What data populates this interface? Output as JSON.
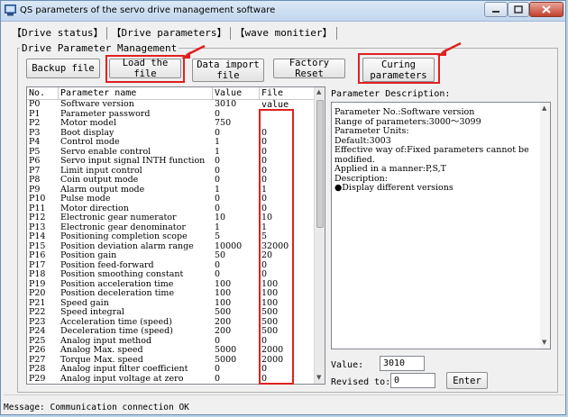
{
  "window": {
    "title": "QS parameters of the servo drive management software"
  },
  "tabs": [
    {
      "label": "【Drive status】"
    },
    {
      "label": "【Drive parameters】"
    },
    {
      "label": "【wave monitier】"
    }
  ],
  "group": {
    "label": "Drive Parameter Management"
  },
  "buttons": {
    "backup": "Backup file",
    "load": "Load the file",
    "import": "Data import file",
    "factory": "Factory Reset",
    "curing": "Curing parameters",
    "enter": "Enter"
  },
  "table": {
    "columns": [
      "No.",
      "Parameter name",
      "Value",
      "File value"
    ],
    "rows": [
      [
        "P0",
        "Software version",
        "3010",
        ""
      ],
      [
        "P1",
        "Parameter password",
        "0",
        ""
      ],
      [
        "P2",
        "Motor model",
        "750",
        ""
      ],
      [
        "P3",
        "Boot display",
        "0",
        "0"
      ],
      [
        "P4",
        "Control mode",
        "1",
        "0"
      ],
      [
        "P5",
        "Servo enable control",
        "1",
        "0"
      ],
      [
        "P6",
        "Servo input signal INTH function",
        "0",
        "0"
      ],
      [
        "P7",
        "Limit input control",
        "0",
        "0"
      ],
      [
        "P8",
        "Coin output mode",
        "0",
        "0"
      ],
      [
        "P9",
        "Alarm output mode",
        "1",
        "1"
      ],
      [
        "P10",
        "Pulse mode",
        "0",
        "0"
      ],
      [
        "P11",
        "Motor direction",
        "0",
        "0"
      ],
      [
        "P12",
        "Electronic gear numerator",
        "10",
        "10"
      ],
      [
        "P13",
        "Electronic gear denominator",
        "1",
        "1"
      ],
      [
        "P14",
        "Positioning completion scope",
        "5",
        "5"
      ],
      [
        "P15",
        "Position deviation alarm range",
        "10000",
        "32000"
      ],
      [
        "P16",
        "Position gain",
        "50",
        "20"
      ],
      [
        "P17",
        "Position feed-forward",
        "0",
        "0"
      ],
      [
        "P18",
        "Position smoothing constant",
        "0",
        "0"
      ],
      [
        "P19",
        "Position acceleration time",
        "100",
        "100"
      ],
      [
        "P20",
        "Position deceleration time",
        "100",
        "100"
      ],
      [
        "P21",
        "Speed gain",
        "100",
        "100"
      ],
      [
        "P22",
        "Speed integral",
        "500",
        "500"
      ],
      [
        "P23",
        "Acceleration time (speed)",
        "200",
        "500"
      ],
      [
        "P24",
        "Deceleration time (speed)",
        "200",
        "500"
      ],
      [
        "P25",
        "Analog input method",
        "0",
        "0"
      ],
      [
        "P26",
        "Analog Max. speed",
        "5000",
        "2000"
      ],
      [
        "P27",
        "Torque Max. speed",
        "5000",
        "2000"
      ],
      [
        "P28",
        "Analog input filter coefficient",
        "0",
        "0"
      ],
      [
        "P29",
        "Analog input voltage at zero",
        "0",
        "0"
      ]
    ]
  },
  "description": {
    "label": "Parameter Description:",
    "lines": [
      "Parameter No.:Software version",
      "Range of parameters:3000～3099",
      "Parameter Units:",
      "Default:3003",
      "Effective way of:Fixed parameters cannot be",
      "modified.",
      "Applied in a manner:P,S,T",
      "Description:",
      "●Display different versions"
    ]
  },
  "value_field": {
    "label": "Value:",
    "value": "3010"
  },
  "revised_field": {
    "label": "Revised to:",
    "value": "0"
  },
  "status": {
    "message": "Message: Communication connection OK"
  },
  "colors": {
    "highlight": "#e02020",
    "titlebar": "#c2d6ee"
  }
}
